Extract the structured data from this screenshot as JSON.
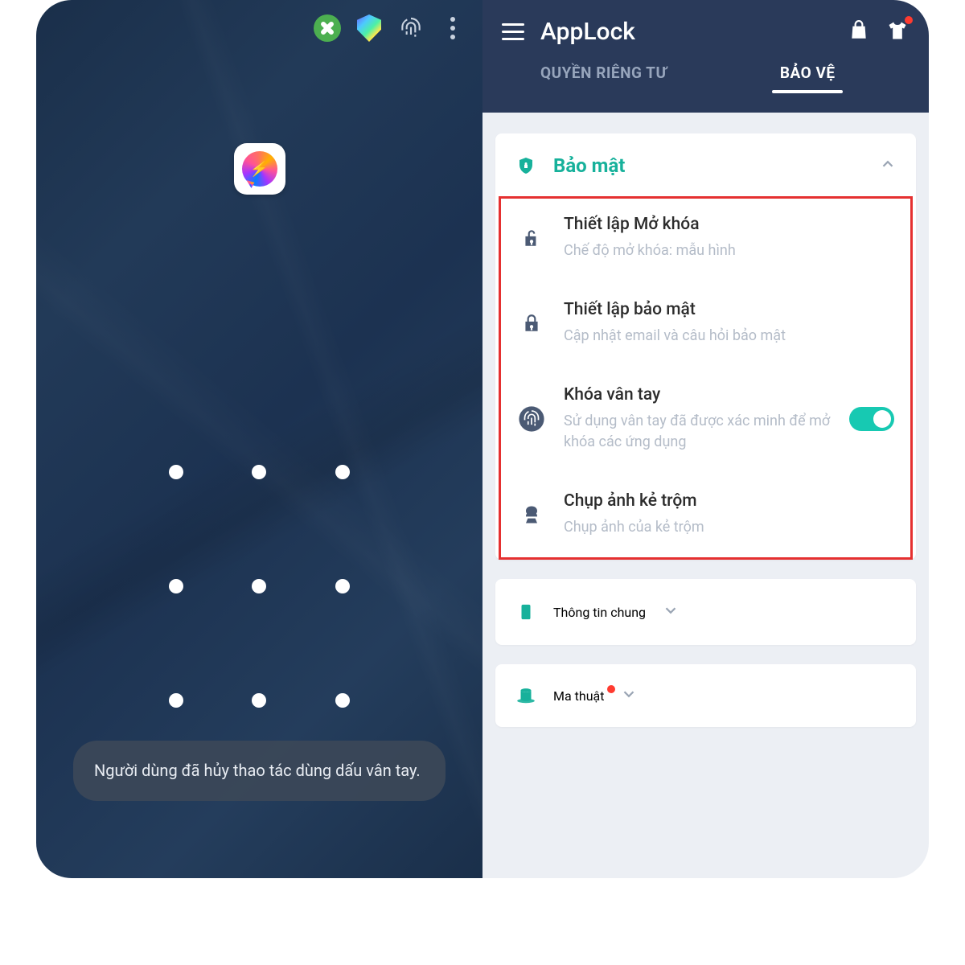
{
  "left": {
    "toast": "Người dùng đã hủy thao tác dùng dấu vân tay."
  },
  "right": {
    "title": "AppLock",
    "tabs": {
      "privacy": "QUYỀN RIÊNG TƯ",
      "protect": "BẢO VỆ"
    },
    "security": {
      "header": "Bảo mật",
      "items": [
        {
          "title": "Thiết lập Mở khóa",
          "desc": "Chế độ mở khóa: mẫu hình"
        },
        {
          "title": "Thiết lập bảo mật",
          "desc": "Cập nhật email và câu hỏi bảo mật"
        },
        {
          "title": "Khóa vân tay",
          "desc": "Sử dụng vân tay đã được xác minh để mở khóa các ứng dụng"
        },
        {
          "title": "Chụp ảnh kẻ trộm",
          "desc": "Chụp ảnh của kẻ trộm"
        }
      ]
    },
    "general": {
      "header": "Thông tin chung"
    },
    "magic": {
      "header": "Ma thuật"
    }
  }
}
